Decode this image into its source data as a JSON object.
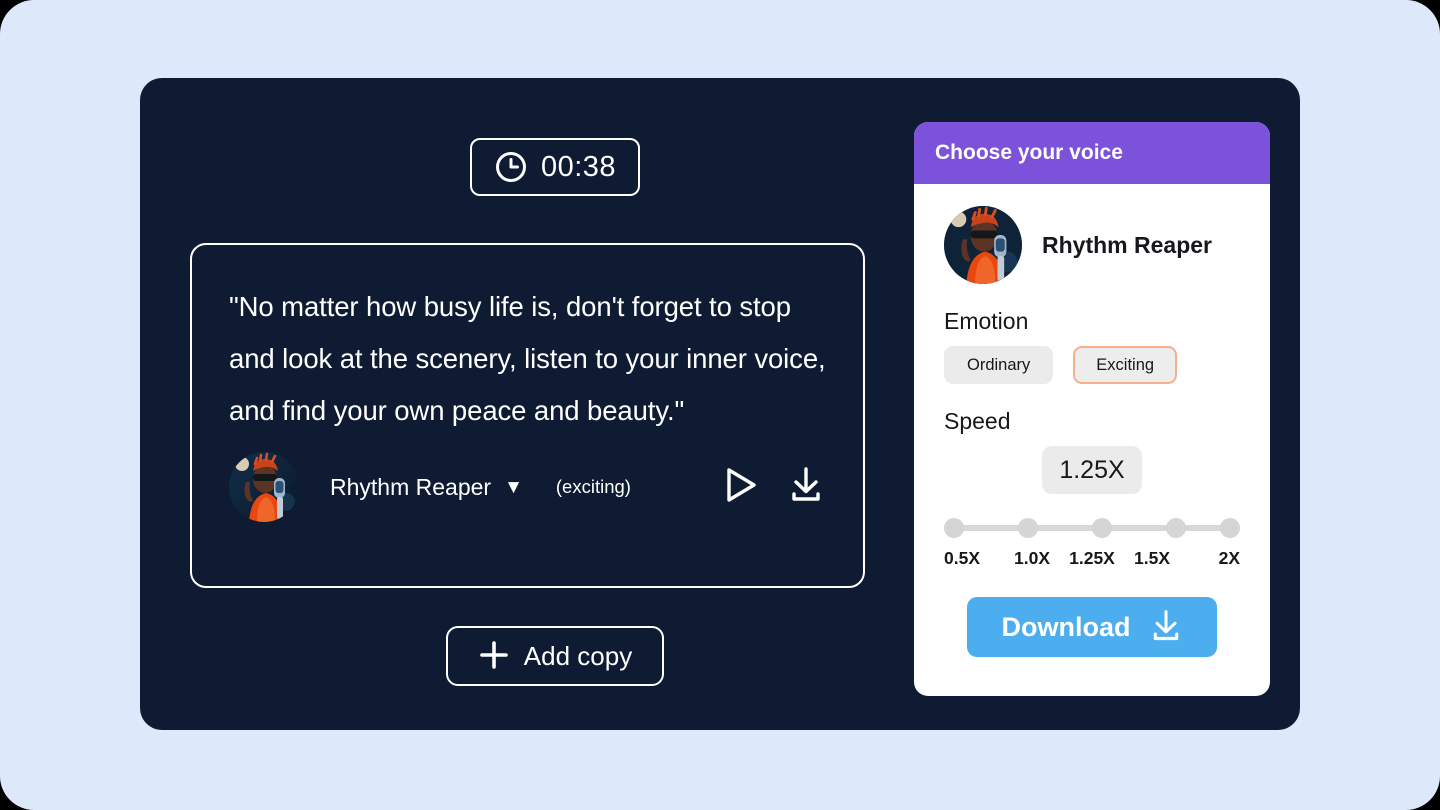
{
  "timer": {
    "icon": "clock-icon",
    "value": "00:38"
  },
  "script_card": {
    "quote": "\"No matter how busy life is, don't forget to stop and look at the scenery, listen to your inner voice, and find your own peace and beauty.\"",
    "player": {
      "voice_name": "Rhythm Reaper",
      "caret": "▼",
      "emotion": "(exciting)",
      "play_icon": "play-icon",
      "download_icon": "download-icon"
    }
  },
  "add_copy": {
    "icon": "plus-icon",
    "label": "Add copy"
  },
  "voice_panel": {
    "title": "Choose your voice",
    "selected_voice": "Rhythm Reaper",
    "emotion": {
      "label": "Emotion",
      "options": [
        {
          "label": "Ordinary",
          "selected": false
        },
        {
          "label": "Exciting",
          "selected": true
        }
      ]
    },
    "speed": {
      "label": "Speed",
      "value": "1.25X",
      "ticks": [
        "0.5X",
        "1.0X",
        "1.25X",
        "1.5X",
        "2X"
      ]
    },
    "download": {
      "label": "Download",
      "icon": "download-icon"
    }
  },
  "colors": {
    "page_background": "#dde9fb",
    "card_background": "#0e1b33",
    "panel_header": "#7c52da",
    "download_button": "#4cadef",
    "selected_chip_border": "#f5b08a",
    "chip_background": "#ebebeb"
  }
}
